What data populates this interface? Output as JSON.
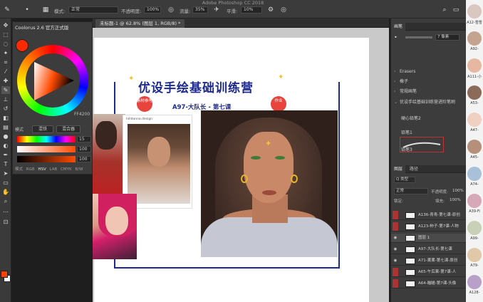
{
  "app_title": "Adobe Photoshop CC 2018",
  "options_bar": {
    "mode_label": "模式:",
    "mode_value": "正常",
    "opacity_label": "不透明度:",
    "opacity_value": "100%",
    "flow_label": "流量:",
    "flow_value": "35%",
    "smooth_label": "平滑:",
    "smooth_value": "10%"
  },
  "document_tab": "未标题-1 @ 62.8% (图层 1, RGB/8) *",
  "tools": [
    "move-icon",
    "marquee-icon",
    "lasso-icon",
    "magic-wand-icon",
    "crop-icon",
    "eyedropper-icon",
    "healing-icon",
    "brush-icon",
    "clone-stamp-icon",
    "history-brush-icon",
    "eraser-icon",
    "gradient-icon",
    "blur-icon",
    "dodge-icon",
    "pen-icon",
    "type-icon",
    "path-select-icon",
    "shape-icon",
    "hand-icon",
    "zoom-icon",
    "more-icon"
  ],
  "coolorus": {
    "title": "Coolorus 2.6 官方正式版",
    "hex": "FF4200",
    "mode_label": "模式",
    "blend_btn1": "混铁",
    "blend_btn2": "混合器",
    "sliders": [
      {
        "value": "15",
        "color": "rainbow"
      },
      {
        "value": "100",
        "color": "#ff4a00"
      },
      {
        "value": "100",
        "color": "#ff4a00"
      }
    ],
    "modes": [
      "模式",
      "RGB",
      "HSV",
      "LAB",
      "CMYK",
      "B/W"
    ],
    "active_mode": "HSV"
  },
  "artwork": {
    "title": "优设手绘基础训练营",
    "subtitle": "A97-大队长 - 第七课",
    "badge_left": "素材参考",
    "badge_right": "作业",
    "photo_caption": "hilldonna.design"
  },
  "brushes_panel": {
    "tab": "画笔",
    "size_value": "7 像素",
    "groups": [
      {
        "label": "Erasers"
      },
      {
        "label": "橡子"
      },
      {
        "label": "常规画笔"
      },
      {
        "label": "优设手绘基础训练营进阶笔刷"
      }
    ],
    "brushes": [
      "硬心铅笔2",
      "铅笔1",
      "铅笔3"
    ]
  },
  "layers_panel": {
    "tabs": [
      "图层",
      "路径"
    ],
    "kind_label": "Q 类型",
    "blend_mode": "正常",
    "opacity_label": "不透明度:",
    "opacity_value": "100%",
    "lock_label": "锁定:",
    "fill_label": "填充:",
    "fill_value": "100%",
    "layers": [
      {
        "name": "A136-青青-第七课-原创",
        "visible": false
      },
      {
        "name": "A123-柿子-第7课-人物",
        "visible": false
      },
      {
        "name": "图层 1",
        "visible": true
      },
      {
        "name": "A97-大队长-第七课",
        "visible": true
      },
      {
        "name": "A71-薰薰-第七课-原创",
        "visible": true
      },
      {
        "name": "A65-午后果-第7课-人",
        "visible": false
      },
      {
        "name": "A64-瞄瞄-第7课-头像",
        "visible": false
      }
    ]
  },
  "participants": [
    {
      "label": "A12-雪雪"
    },
    {
      "label": "A92-"
    },
    {
      "label": "A111-小"
    },
    {
      "label": "A53-"
    },
    {
      "label": "A47-"
    },
    {
      "label": "A45-"
    },
    {
      "label": "A74-"
    },
    {
      "label": "A39-Fi"
    },
    {
      "label": "A99-"
    },
    {
      "label": "A79-"
    },
    {
      "label": "A128-"
    }
  ]
}
